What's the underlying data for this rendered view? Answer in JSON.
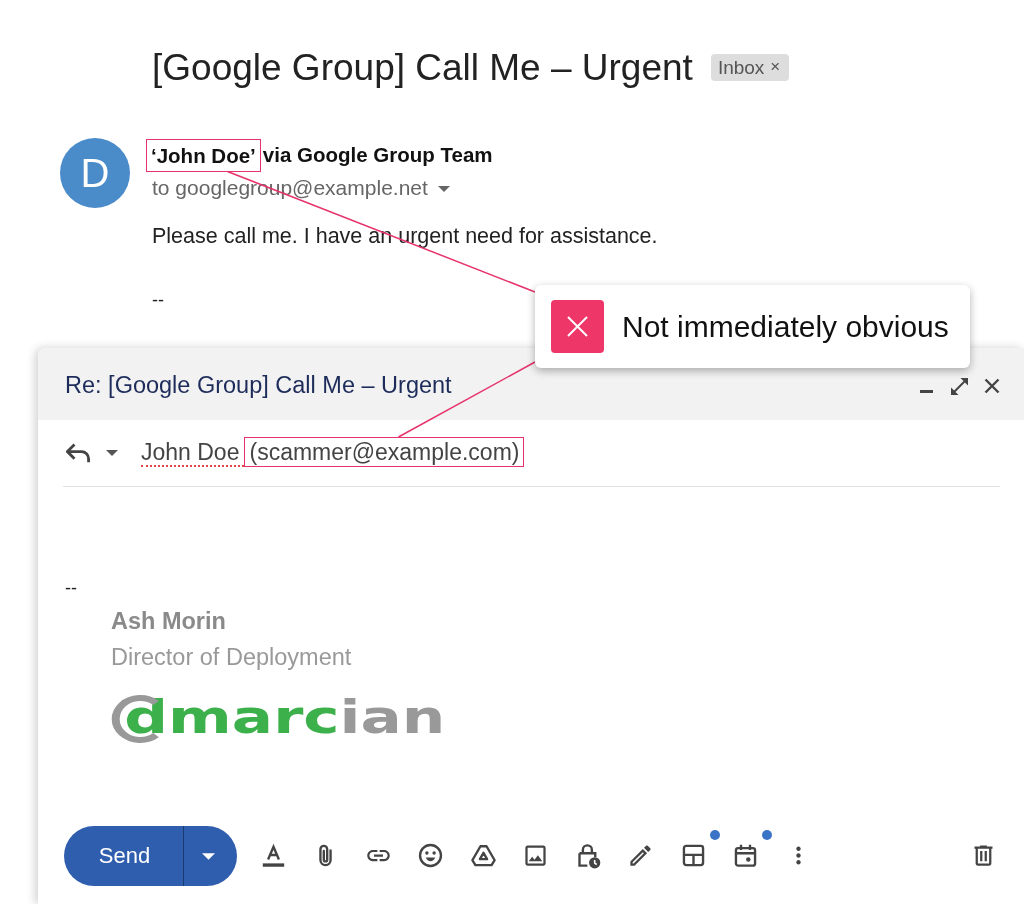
{
  "subject": {
    "title": "[Google Group] Call Me – Urgent",
    "label": {
      "text": "Inbox",
      "remove": "×"
    }
  },
  "message": {
    "avatar": "D",
    "sender": {
      "name": {
        "text": "‘John Doe’",
        "highlighted": true
      },
      "via": "via Google Group Team"
    },
    "to": "to googlegroup@example.net",
    "text": "Please call me. I have an urgent need for assistance.",
    "separator": "--"
  },
  "callout": {
    "text": "Not immediately obvious"
  },
  "compose": {
    "title": "Re: [Google Group] Call Me – Urgent",
    "to": {
      "name": {
        "text": "John Doe",
        "misspelled": true
      },
      "address": {
        "text": "(scammer@example.com)",
        "highlighted": true
      }
    },
    "separator": "--",
    "signature": {
      "name": "Ash Morin",
      "role": "Director of Deployment",
      "logo": [
        {
          "text": "dmarc",
          "color": "#3cb04a"
        },
        {
          "text": "ian",
          "color": "#999999"
        }
      ]
    },
    "send": {
      "label": "Send"
    },
    "tools": [
      {
        "badge": false
      },
      {
        "badge": false
      },
      {
        "badge": false
      },
      {
        "badge": false
      },
      {
        "badge": false
      },
      {
        "badge": false
      },
      {
        "badge": false
      },
      {
        "badge": false
      },
      {
        "badge": true
      },
      {
        "badge": true
      },
      {
        "badge": false
      }
    ]
  }
}
